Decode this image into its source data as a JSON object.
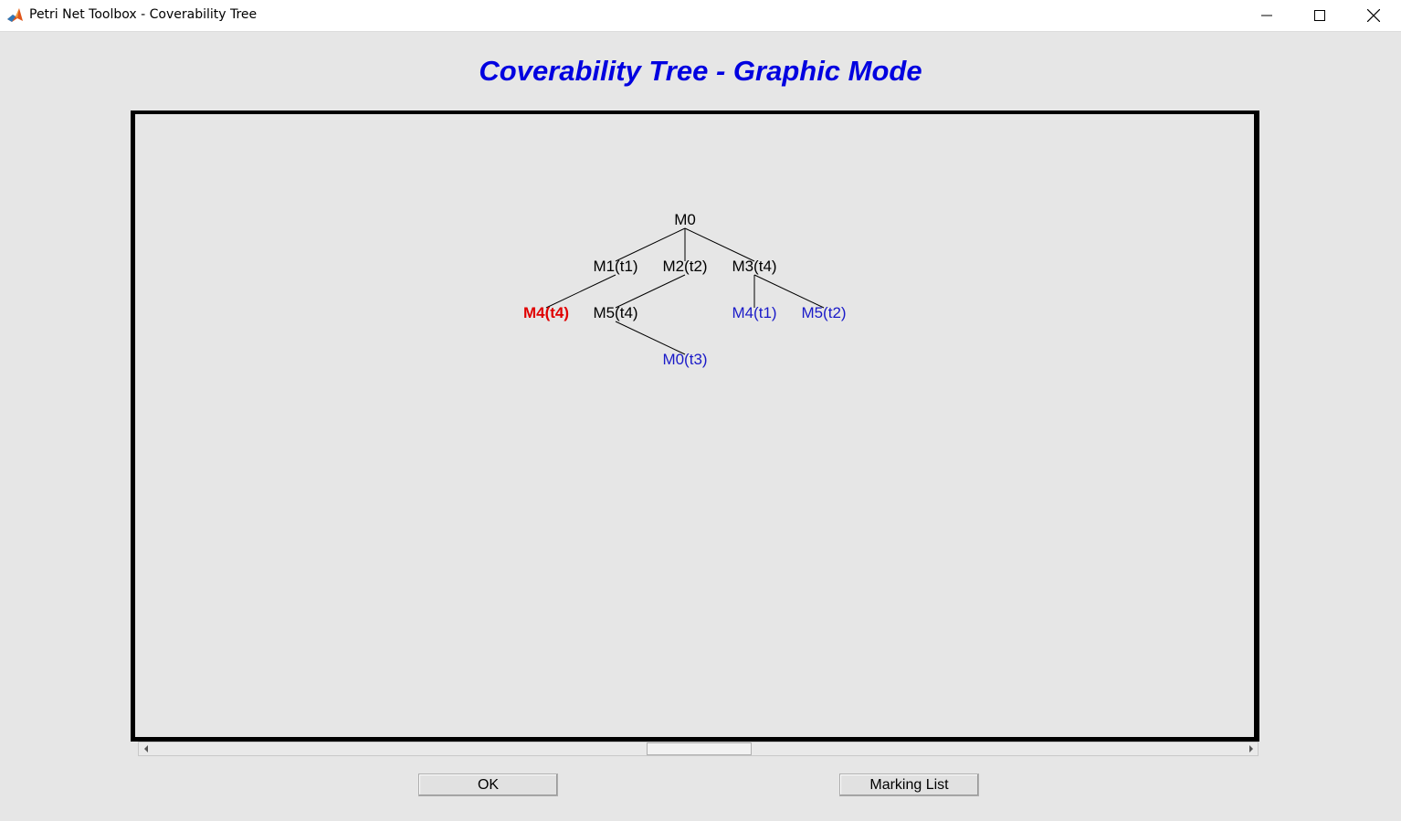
{
  "window": {
    "title": "Petri Net Toolbox - Coverability Tree",
    "icon": "matlab-icon",
    "controls": [
      "minimize-icon",
      "maximize-icon",
      "close-icon"
    ]
  },
  "heading": "Coverability Tree - Graphic Mode",
  "tree": {
    "root": "M0",
    "level1": [
      "M1(t1)",
      "M2(t2)",
      "M3(t4)"
    ],
    "level2": [
      "M4(t4)",
      "M5(t4)",
      "M4(t1)",
      "M5(t2)"
    ],
    "level3": [
      "M0(t3)"
    ],
    "edges": [
      [
        "M0",
        "M1(t1)"
      ],
      [
        "M0",
        "M2(t2)"
      ],
      [
        "M0",
        "M3(t4)"
      ],
      [
        "M1(t1)",
        "M4(t4)"
      ],
      [
        "M2(t2)",
        "M5(t4)"
      ],
      [
        "M3(t4)",
        "M4(t1)"
      ],
      [
        "M3(t4)",
        "M5(t2)"
      ],
      [
        "M5(t4)",
        "M0(t3)"
      ]
    ],
    "node_colors": {
      "normal": "#000000",
      "repeated": "#1a1ac8",
      "highlighted": "#e00000"
    }
  },
  "buttons": {
    "ok": "OK",
    "marking_list": "Marking List"
  }
}
